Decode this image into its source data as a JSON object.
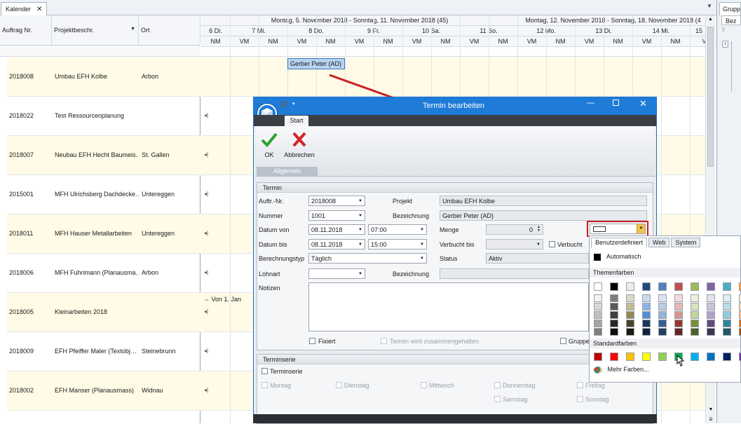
{
  "tabs": {
    "calendar_tab": "Kalender",
    "groups_tab": "Gruppen",
    "groups_search": "Bez"
  },
  "left_grid": {
    "headers": {
      "order_no": "Auftrag Nr.",
      "project_desc": "Projektbeschr.",
      "place": "Ort"
    },
    "rows": [
      {
        "order_no": "2018008",
        "project": "Umbau EFH Kolbe",
        "place": "Arbon",
        "highlight": true
      },
      {
        "order_no": "2018022",
        "project": "Test Ressourcenplanung",
        "place": "",
        "highlight": false
      },
      {
        "order_no": "2018007",
        "project": "Neubau EFH Hecht Baumeis…",
        "place": "St. Gallen",
        "highlight": true
      },
      {
        "order_no": "2015001",
        "project": "MFH Ulrichsberg Dachdecke…",
        "place": "Untereggen",
        "highlight": false
      },
      {
        "order_no": "2018011",
        "project": "MFH Hauser Metallarbeiten",
        "place": "Untereggen",
        "highlight": true
      },
      {
        "order_no": "2018006",
        "project": "MFH Fuhrimann (Planausma…",
        "place": "Arbon",
        "highlight": false
      },
      {
        "order_no": "2018005",
        "project": "Kleinarbeiten 2018",
        "place": "",
        "highlight": true
      },
      {
        "order_no": "2018009",
        "project": "EFH Pfeiffer Maler (Textobj…",
        "place": "Steinebrunn",
        "highlight": false
      },
      {
        "order_no": "2018002",
        "project": "EFH Manser (Planausmass)",
        "place": "Widnau",
        "highlight": true
      }
    ]
  },
  "calendar": {
    "week1": "Montag, 5. November 2018 - Sonntag, 11. November 2018 (45)",
    "week2": "Montag, 12. November 2018 - Sonntag, 18. November 2018 (4",
    "days": [
      "6 Di.",
      "7 Mi.",
      "8 Do.",
      "9 Fr.",
      "10 Sa.",
      "11 So.",
      "12 Mo.",
      "13 Di.",
      "14 Mi.",
      "15"
    ],
    "halfdays": [
      "NM",
      "VM",
      "NM",
      "VM",
      "NM",
      "VM",
      "NM",
      "VM",
      "NM",
      "VM",
      "NM",
      "VM",
      "NM",
      "VM",
      "NM",
      "VM",
      "NM",
      "V"
    ],
    "appointment": "Gerber Peter (AD)",
    "von_label": "Von 1. Jan"
  },
  "dialog": {
    "title": "Termin bearbeiten",
    "ribbon_tab": "Start",
    "ok_label": "OK",
    "cancel_label": "Abbrechen",
    "group_label": "Allgemein",
    "section_termin": "Termin",
    "auftr_label": "Auftr.-Nr.",
    "auftr_value": "2018008",
    "projekt_label": "Projekt",
    "projekt_value": "Umbau EFH Kolbe",
    "nummer_label": "Nummer",
    "nummer_value": "1001",
    "bezeichnung_label": "Bezeichnung",
    "bezeichnung_value": "Gerber Peter (AD)",
    "datum_von_label": "Datum von",
    "datum_von_value": "08.11.2018",
    "zeit_von_value": "07:00",
    "menge_label": "Menge",
    "menge_value": "0",
    "datum_bis_label": "Datum bis",
    "datum_bis_value": "08.11.2018",
    "zeit_bis_value": "15:00",
    "verbucht_bis_label": "Verbucht bis",
    "verbucht_label": "Verbucht",
    "berechnungstyp_label": "Berechnungstyp",
    "berechnungstyp_value": "Täglich",
    "status_label": "Status",
    "status_value": "Aktiv",
    "lohnart_label": "Lohnart",
    "bezeichnung2_label": "Bezeichnung",
    "notizen_label": "Notizen",
    "fixiert_label": "Fixiert",
    "zusammen_label": "Termin wird zusammengehalten",
    "gruppe_label": "Gruppe",
    "section_serie": "Terminserie",
    "terminserie_label": "Terminserie",
    "weekdays": {
      "mo": "Montag",
      "di": "Dienstag",
      "mi": "Mittwoch",
      "do": "Donnerstag",
      "fr": "Freitag",
      "sa": "Samstag",
      "so": "Sonntag"
    }
  },
  "color_picker": {
    "tabs": [
      "Benutzerdefiniert",
      "Web",
      "System"
    ],
    "automatic_label": "Automatisch",
    "theme_label": "Themenfarben",
    "standard_label": "Standardfarben",
    "more_colors_label": "Mehr Farben...",
    "theme_top": [
      "#ffffff",
      "#000000",
      "#eeece1",
      "#1f497d",
      "#4f81bd",
      "#c0504d",
      "#9bbb59",
      "#8064a2",
      "#4bacc6",
      "#f79646"
    ],
    "theme_shades": [
      [
        "#f2f2f2",
        "#7f7f7f",
        "#ddd9c3",
        "#c6d9f0",
        "#dbe5f1",
        "#f2dcdb",
        "#ebf1dd",
        "#e5e0ec",
        "#dbeef3",
        "#fdeada"
      ],
      [
        "#d8d8d8",
        "#595959",
        "#c4bd97",
        "#8db3e2",
        "#b8cce4",
        "#e5b9b7",
        "#d7e3bc",
        "#ccc1d9",
        "#b7dde8",
        "#fbd5b5"
      ],
      [
        "#bfbfbf",
        "#3f3f3f",
        "#938953",
        "#548dd4",
        "#95b3d7",
        "#d99694",
        "#c3d69b",
        "#b2a2c7",
        "#92cddc",
        "#fac08f"
      ],
      [
        "#a5a5a5",
        "#262626",
        "#494429",
        "#17365d",
        "#366092",
        "#953734",
        "#76923c",
        "#5f497a",
        "#31859b",
        "#e36c09"
      ],
      [
        "#7f7f7f",
        "#0c0c0c",
        "#1d1b10",
        "#0f243e",
        "#244061",
        "#632423",
        "#4f6128",
        "#3f3151",
        "#205867",
        "#974806"
      ]
    ],
    "standard_colors": [
      "#c00000",
      "#ff0000",
      "#ffc000",
      "#ffff00",
      "#92d050",
      "#00b050",
      "#00b0f0",
      "#0070c0",
      "#002060",
      "#7030a0"
    ]
  },
  "colors": {
    "title_blue": "#1e7bd8",
    "highlight_row": "#fffbe6",
    "annotation_red": "#cc1f1f"
  }
}
